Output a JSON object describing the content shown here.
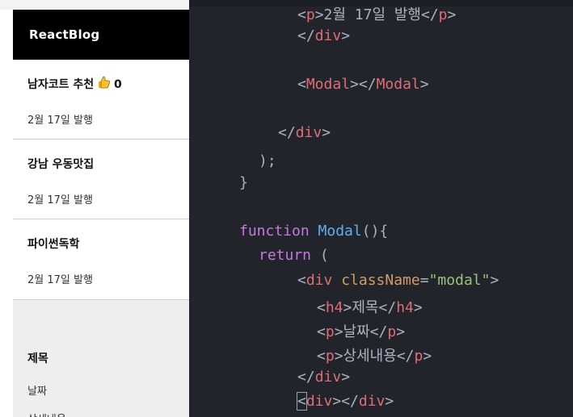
{
  "browser": {
    "brand": "ReactBlog",
    "posts": [
      {
        "title": "남자코트 추천",
        "likes": "0",
        "date": "2월 17일 발행"
      },
      {
        "title": "강남 우동맛집",
        "date": "2월 17일 발행"
      },
      {
        "title": "파이썬독학",
        "date": "2월 17일 발행"
      }
    ],
    "modal": {
      "title": "제목",
      "date": "날짜",
      "detail": "상세내용"
    }
  },
  "editor": {
    "lines": [
      "<p>2월 17일 발행</p>",
      "</div>",
      "<Modal></Modal>",
      "</div>",
      ");",
      "}",
      "function Modal(){",
      "return (",
      "<div className=\"modal\">",
      "<h4>제목</h4>",
      "<p>날짜</p>",
      "<p>상세내용</p>",
      "</div>",
      "<div></div>"
    ]
  },
  "colors": {
    "editor_bg": "#21252b",
    "tag": "#e06c75",
    "function_name": "#61afef",
    "keyword": "#c678dd",
    "attribute": "#d19a66",
    "string": "#98c379",
    "nav_bg": "#000000"
  }
}
